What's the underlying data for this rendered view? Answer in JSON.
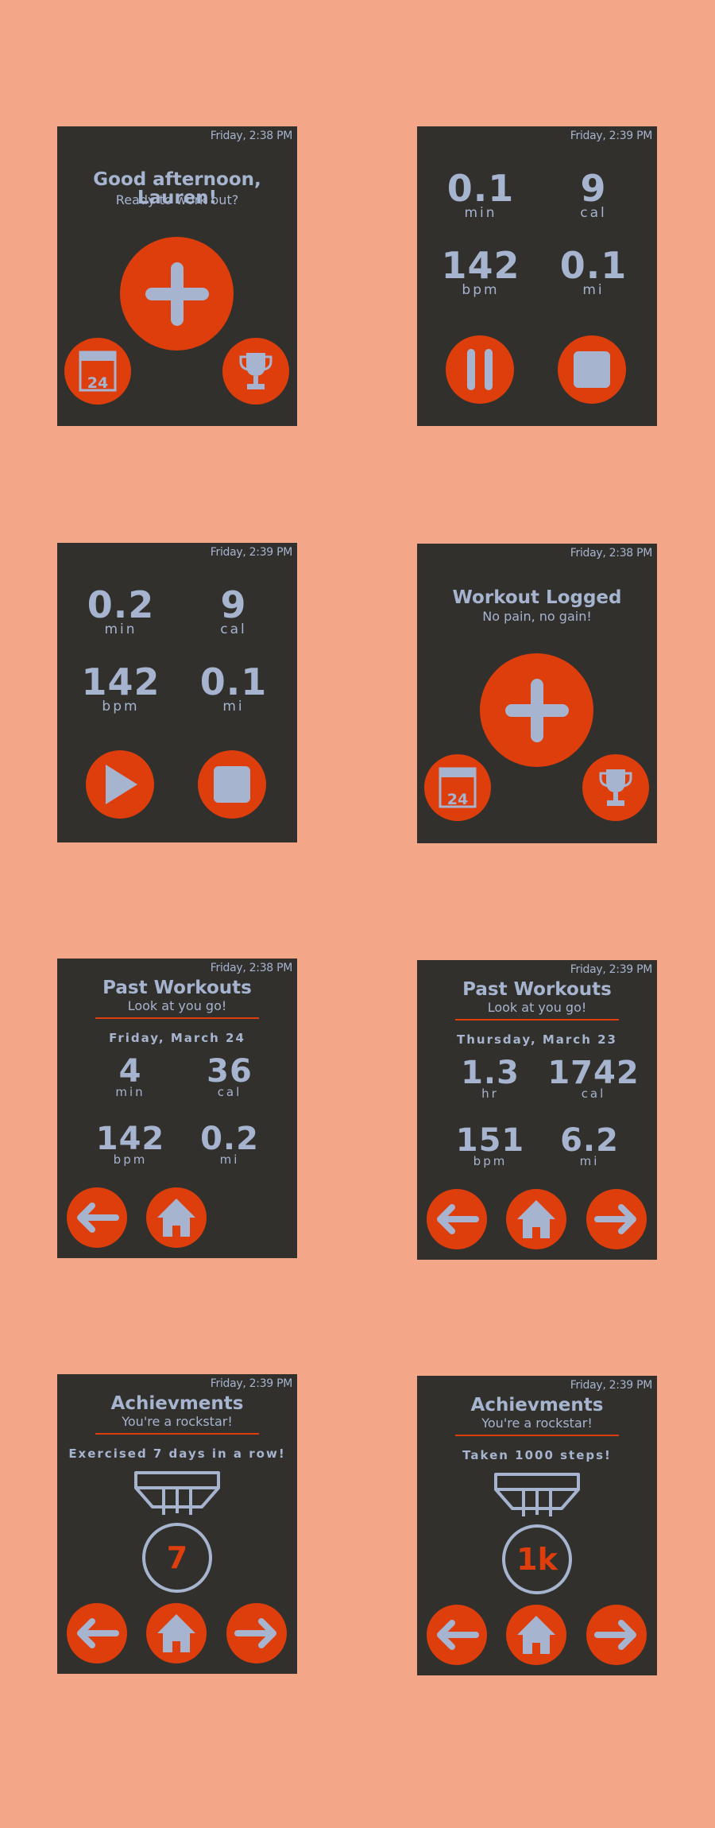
{
  "colors": {
    "background": "#f4a788",
    "screen": "#31302c",
    "accent": "#de3d0c",
    "text": "#a6b4cf"
  },
  "screens": {
    "home": {
      "time": "Friday, 2:38 PM",
      "greeting": "Good afternoon, Lauren!",
      "subtitle": "Ready to work out?",
      "calendar_day": "24",
      "icons": [
        "plus-icon",
        "calendar-icon",
        "trophy-icon"
      ]
    },
    "workout_running": {
      "time": "Friday, 2:39 PM",
      "stats": [
        {
          "value": "0.1",
          "unit": "min"
        },
        {
          "value": "9",
          "unit": "cal"
        },
        {
          "value": "142",
          "unit": "bpm"
        },
        {
          "value": "0.1",
          "unit": "mi"
        }
      ],
      "icons": [
        "pause-icon",
        "stop-icon"
      ]
    },
    "workout_paused": {
      "time": "Friday, 2:39 PM",
      "stats": [
        {
          "value": "0.2",
          "unit": "min"
        },
        {
          "value": "9",
          "unit": "cal"
        },
        {
          "value": "142",
          "unit": "bpm"
        },
        {
          "value": "0.1",
          "unit": "mi"
        }
      ],
      "icons": [
        "play-icon",
        "stop-icon"
      ]
    },
    "workout_logged": {
      "time": "Friday, 2:38 PM",
      "title": "Workout Logged",
      "subtitle": "No pain, no gain!",
      "calendar_day": "24",
      "icons": [
        "plus-icon",
        "calendar-icon",
        "trophy-icon"
      ]
    },
    "past_1": {
      "time": "Friday, 2:38 PM",
      "title": "Past Workouts",
      "subtitle": "Look at you go!",
      "date": "Friday, March 24",
      "stats": [
        {
          "value": "4",
          "unit": "min"
        },
        {
          "value": "36",
          "unit": "cal"
        },
        {
          "value": "142",
          "unit": "bpm"
        },
        {
          "value": "0.2",
          "unit": "mi"
        }
      ],
      "icons": [
        "arrow-left-icon",
        "home-icon"
      ]
    },
    "past_2": {
      "time": "Friday, 2:39 PM",
      "title": "Past Workouts",
      "subtitle": "Look at you go!",
      "date": "Thursday, March 23",
      "stats": [
        {
          "value": "1.3",
          "unit": "hr"
        },
        {
          "value": "1742",
          "unit": "cal"
        },
        {
          "value": "151",
          "unit": "bpm"
        },
        {
          "value": "6.2",
          "unit": "mi"
        }
      ],
      "icons": [
        "arrow-left-icon",
        "home-icon",
        "arrow-right-icon"
      ]
    },
    "ach_1": {
      "time": "Friday, 2:39 PM",
      "title": "Achievments",
      "subtitle": "You're a rockstar!",
      "text": "Exercised 7 days in a row!",
      "medal": "7",
      "icons": [
        "arrow-left-icon",
        "home-icon",
        "arrow-right-icon"
      ]
    },
    "ach_2": {
      "time": "Friday, 2:39 PM",
      "title": "Achievments",
      "subtitle": "You're a rockstar!",
      "text": "Taken 1000 steps!",
      "medal": "1k",
      "icons": [
        "arrow-left-icon",
        "home-icon",
        "arrow-right-icon"
      ]
    }
  }
}
